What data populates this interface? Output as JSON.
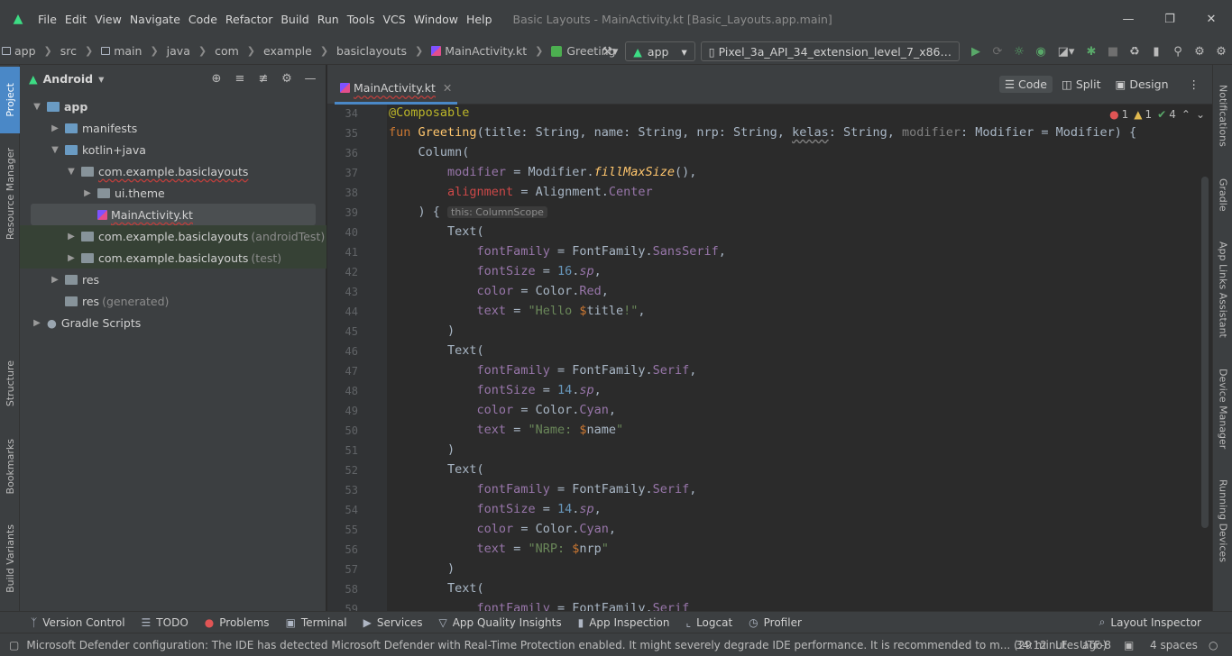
{
  "window": {
    "menu": [
      "File",
      "Edit",
      "View",
      "Navigate",
      "Code",
      "Refactor",
      "Build",
      "Run",
      "Tools",
      "VCS",
      "Window",
      "Help"
    ],
    "title": "Basic Layouts - MainActivity.kt [Basic_Layouts.app.main]"
  },
  "breadcrumb": [
    "app",
    "src",
    "main",
    "java",
    "com",
    "example",
    "basiclayouts",
    "MainActivity.kt",
    "Greeting"
  ],
  "toolbar": {
    "run_config": "app",
    "device": "Pixel_3a_API_34_extension_level_7_x86…"
  },
  "left_tabs": [
    "Project",
    "Resource Manager",
    "Structure",
    "Bookmarks",
    "Build Variants"
  ],
  "right_tabs": [
    "Notifications",
    "Gradle",
    "App Links Assistant",
    "Device Manager",
    "Running Devices"
  ],
  "project": {
    "view": "Android",
    "tree": [
      {
        "label": "app",
        "extra": ""
      },
      {
        "label": "manifests",
        "extra": ""
      },
      {
        "label": "kotlin+java",
        "extra": ""
      },
      {
        "label": "com.example.basiclayouts",
        "extra": ""
      },
      {
        "label": "ui.theme",
        "extra": ""
      },
      {
        "label": "MainActivity.kt",
        "extra": ""
      },
      {
        "label": "com.example.basiclayouts",
        "extra": "(androidTest)"
      },
      {
        "label": "com.example.basiclayouts",
        "extra": "(test)"
      },
      {
        "label": "res",
        "extra": ""
      },
      {
        "label": "res",
        "extra": "(generated)"
      },
      {
        "label": "Gradle Scripts",
        "extra": ""
      }
    ]
  },
  "editor": {
    "tab": "MainActivity.kt",
    "modes": [
      "Code",
      "Split",
      "Design"
    ],
    "inspections": {
      "errors": "1",
      "warnings": "1",
      "ok": "4"
    },
    "hint": "this: ColumnScope",
    "line_numbers": [
      "34",
      "35",
      "36",
      "37",
      "38",
      "39",
      "40",
      "41",
      "42",
      "43",
      "44",
      "45",
      "46",
      "47",
      "48",
      "49",
      "50",
      "51",
      "52",
      "53",
      "54",
      "55",
      "56",
      "57",
      "58",
      "59"
    ]
  },
  "bottom_tools": [
    "Version Control",
    "TODO",
    "Problems",
    "Terminal",
    "Services",
    "App Quality Insights",
    "App Inspection",
    "Logcat",
    "Profiler",
    "Layout Inspector"
  ],
  "status": {
    "message": "Microsoft Defender configuration: The IDE has detected Microsoft Defender with Real-Time Protection enabled. It might severely degrade IDE performance. It is recommended to m... (29 minutes ago)",
    "position": "34:12",
    "line_sep": "LF",
    "encoding": "UTF-8",
    "indent": "4 spaces"
  }
}
